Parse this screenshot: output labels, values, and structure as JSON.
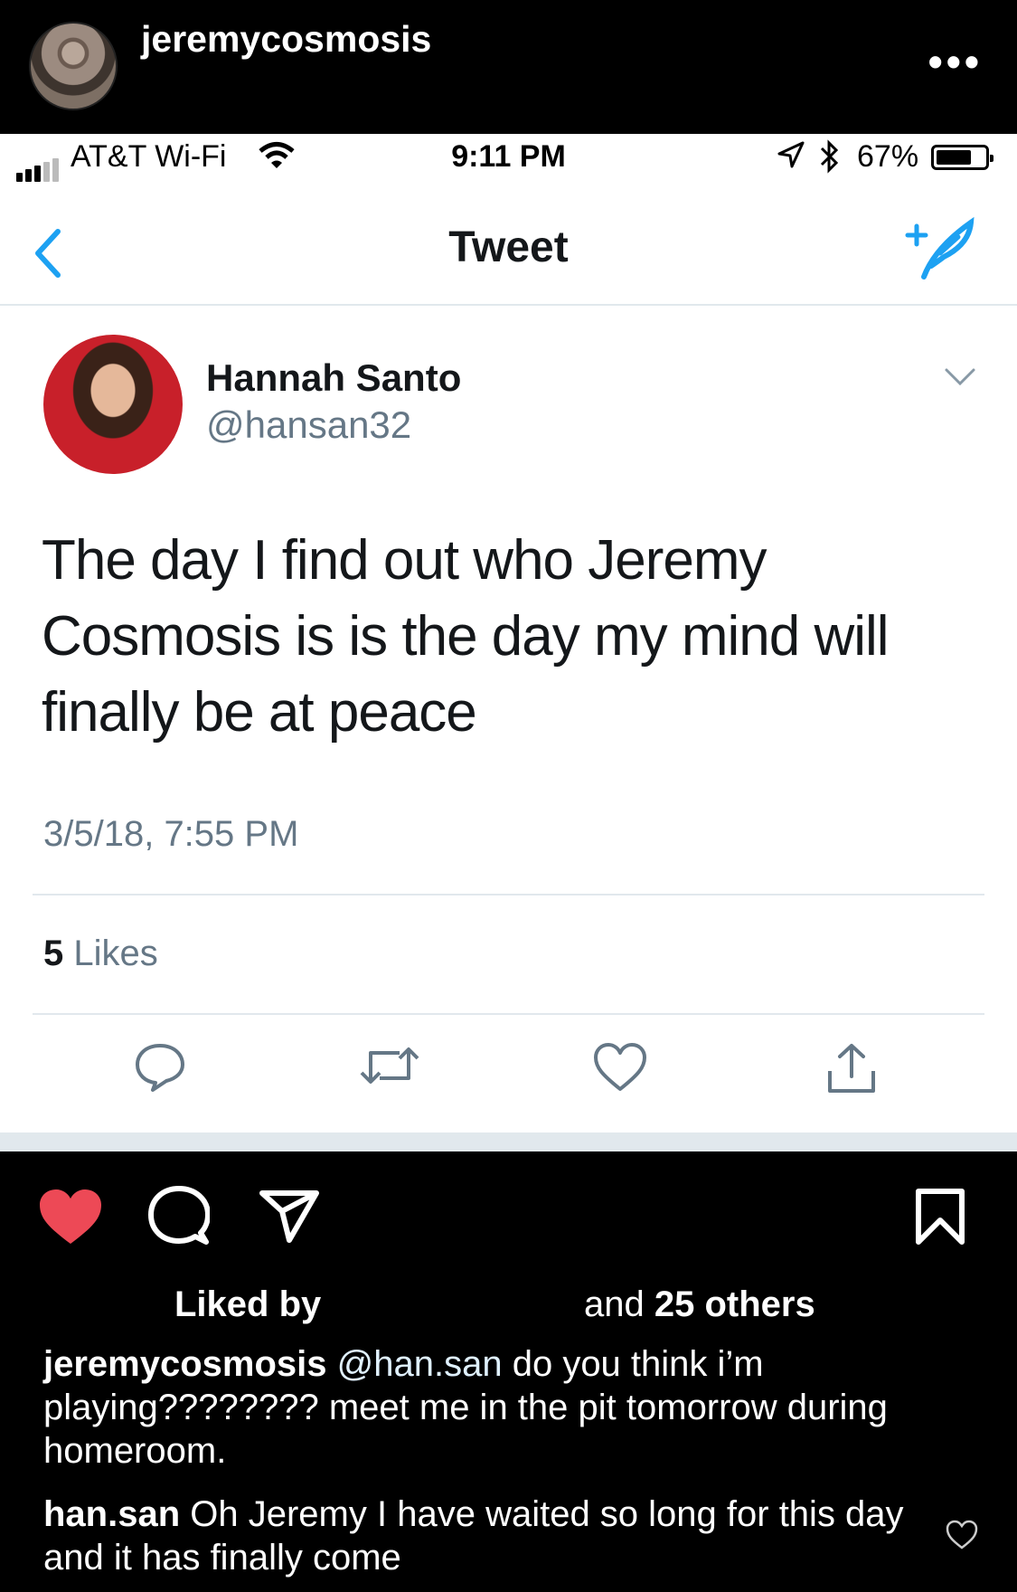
{
  "instagram": {
    "username": "jeremycosmosis",
    "more_label": "•••",
    "liked_by_prefix": "Liked by",
    "liked_by_and": "and",
    "liked_by_count": "25 others",
    "comments": [
      {
        "user": "jeremycosmosis",
        "mention": "@han.san",
        "text": " do you think i’m playing???????? meet me in the pit tomorrow during homeroom."
      },
      {
        "user": "han.san",
        "text": " Oh Jeremy I have waited so long for this day and it has finally come"
      }
    ],
    "icons": [
      "heart-filled-icon",
      "comment-icon",
      "share-icon",
      "bookmark-icon",
      "heart-outline-icon"
    ],
    "colors": {
      "heart": "#ed4956",
      "background": "#000000"
    }
  },
  "phone_status": {
    "carrier": "AT&T Wi-Fi",
    "time": "9:11 PM",
    "battery": "67%"
  },
  "tweet": {
    "nav_title": "Tweet",
    "author_name": "Hannah Santo",
    "author_handle": "@hansan32",
    "text": "The day I find out who Jeremy Cosmosis is is the day my mind will finally be at peace",
    "date": "3/5/18, 7:55 PM",
    "likes_count": "5",
    "likes_label": " Likes",
    "colors": {
      "accent": "#1da1f2",
      "secondary_text": "#657786"
    }
  }
}
